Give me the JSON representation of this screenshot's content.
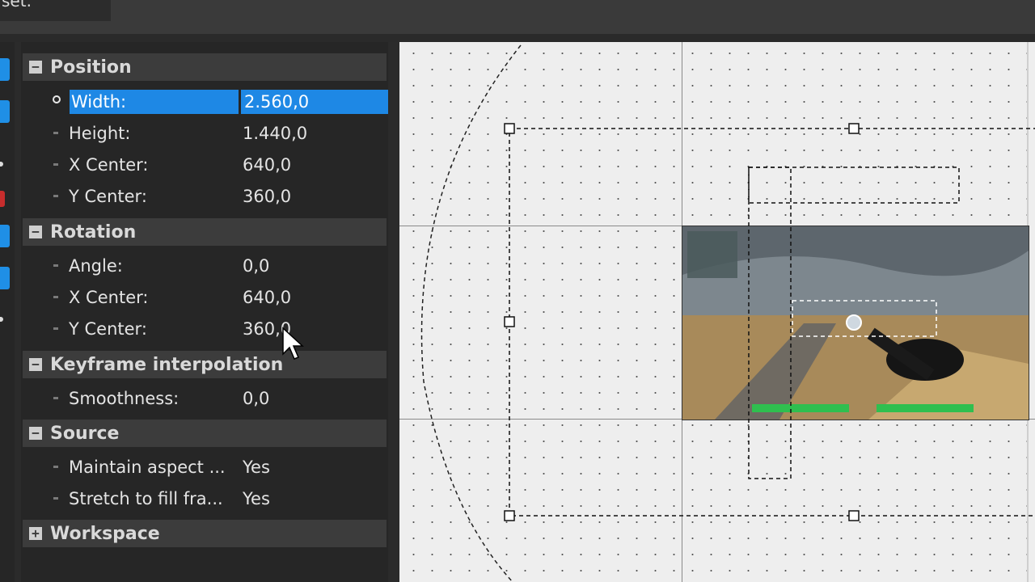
{
  "window": {
    "tab_fragment": "set."
  },
  "panel": {
    "sections": [
      {
        "title": "Position",
        "toggle": "−",
        "rows": [
          {
            "label": "Width:",
            "value": "2.560,0",
            "selected": true
          },
          {
            "label": "Height:",
            "value": "1.440,0"
          },
          {
            "label": "X Center:",
            "value": "640,0"
          },
          {
            "label": "Y Center:",
            "value": "360,0"
          }
        ]
      },
      {
        "title": "Rotation",
        "toggle": "−",
        "rows": [
          {
            "label": "Angle:",
            "value": "0,0"
          },
          {
            "label": "X Center:",
            "value": "640,0"
          },
          {
            "label": "Y Center:",
            "value": "360,0"
          }
        ]
      },
      {
        "title": "Keyframe interpolation",
        "toggle": "−",
        "rows": [
          {
            "label": "Smoothness:",
            "value": "0,0"
          }
        ]
      },
      {
        "title": "Source",
        "toggle": "−",
        "rows": [
          {
            "label": "Maintain aspect ...",
            "value": "Yes"
          },
          {
            "label": "Stretch to fill fra...",
            "value": "Yes"
          }
        ]
      },
      {
        "title": "Workspace",
        "toggle": "+",
        "rows": []
      }
    ]
  },
  "preview": {
    "frame_content": "game-screenshot-thumbnail"
  }
}
